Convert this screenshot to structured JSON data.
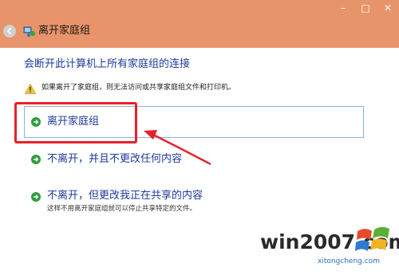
{
  "window": {
    "title": "离开家庭组",
    "minimize_glyph": "–",
    "maximize_glyph": "□",
    "close_glyph": "✕"
  },
  "heading": "会断开此计算机上所有家庭组的连接",
  "warning": "如果离开了家庭组，则无法访问或共享家庭组文件和打印机。",
  "options": [
    {
      "title": "离开家庭组",
      "description": "",
      "icon": "green-arrow-icon",
      "selected": true
    },
    {
      "title": "不离开，并且不更改任何内容",
      "description": "",
      "icon": "green-arrow-icon",
      "selected": false
    },
    {
      "title": "不离开，但更改我正在共享的内容",
      "description": "这样不用离开家庭组就可以停止共享特定的文件。",
      "icon": "green-arrow-icon",
      "selected": false
    }
  ],
  "watermark": {
    "main": "win2007.com",
    "sub": "xitongcheng.com"
  },
  "colors": {
    "titlebar": "#e8946a",
    "link_blue": "#1e3a9c",
    "annotation_red": "#e8202a",
    "option_border": "#8ab4d8",
    "arrow_green": "#2e9e3a"
  }
}
